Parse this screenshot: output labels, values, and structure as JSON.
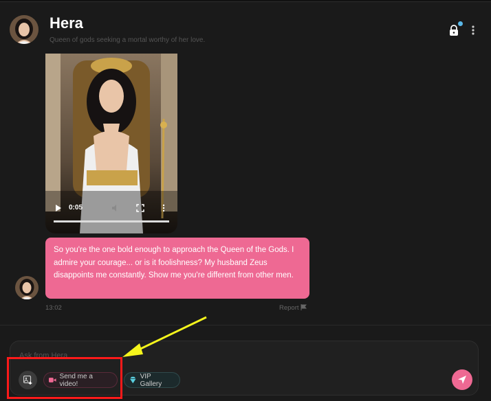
{
  "header": {
    "name": "Hera",
    "tagline": "Queen of gods seeking a mortal worthy of her love.",
    "lock_icon": "lock-icon",
    "more_icon": "more-vertical-icon",
    "notification_dot_color": "#5ab8e8"
  },
  "video": {
    "time": "0:05",
    "progress": 1.0
  },
  "message": {
    "text": "So you're the one bold enough to approach the Queen of the Gods. I admire your courage... or is it foolishness? My husband Zeus disappoints me constantly. Show me you're different from other men.",
    "time": "13:02",
    "report_label": "Report",
    "bubble_color": "#ee6993"
  },
  "composer": {
    "placeholder": "Ask from Hera",
    "chips": [
      {
        "label": "Send me a video!",
        "icon": "video-camera-icon",
        "icon_color": "#ee6993"
      },
      {
        "label": "VIP Gallery",
        "icon": "gem-icon",
        "icon_color": "#5ad0e0"
      }
    ],
    "send_icon": "send-icon",
    "send_color": "#ee6993"
  },
  "annotation": {
    "box_color": "#ff1a1a",
    "arrow_color": "#f5f51c"
  }
}
